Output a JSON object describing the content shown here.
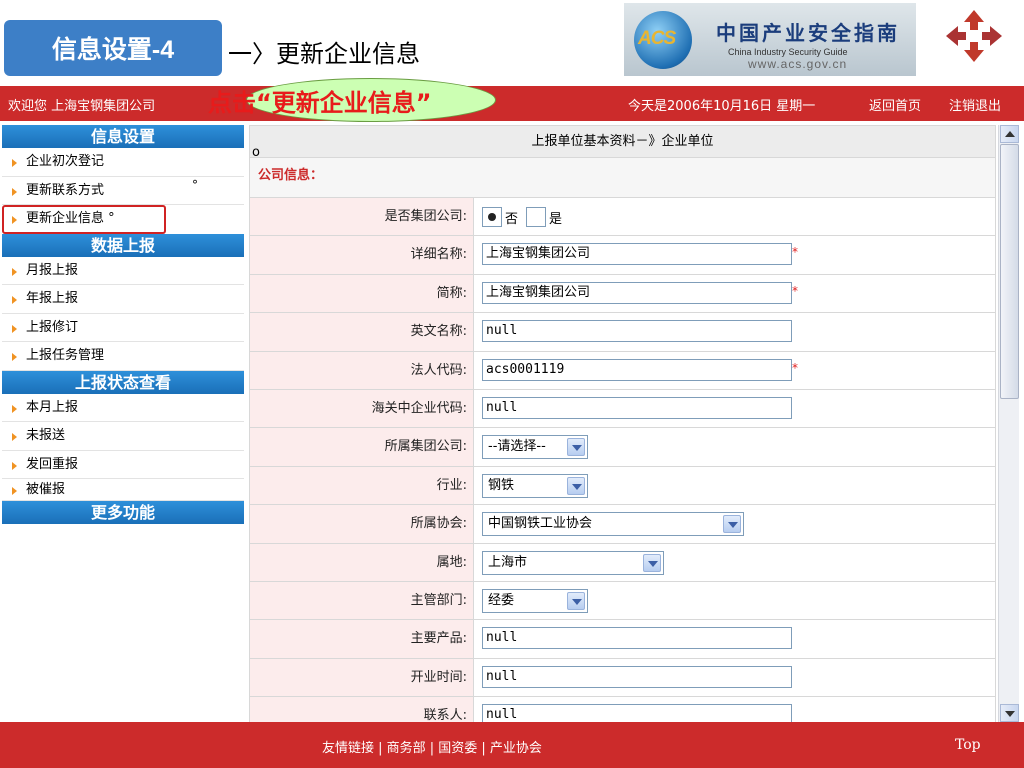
{
  "slide": {
    "title": "信息设置-4",
    "subtitle": "一〉更新企业信息"
  },
  "logo": {
    "acs": "ACS",
    "cn": "中国产业安全指南",
    "en": "China  Industry  Security  Guide",
    "url": "www.acs.gov.cn"
  },
  "topbar": {
    "welcome": "欢迎您 上海宝钢集团公司",
    "callout": "点击“更新企业信息”",
    "date": "今天是2006年10月16日  星期一",
    "home": "返回首页",
    "logout": "注销退出"
  },
  "sidebar": {
    "group1": "信息设置",
    "group1_items": [
      "企业初次登记",
      "更新联系方式",
      "更新企业信息 °"
    ],
    "group2": "数据上报",
    "group2_items": [
      "月报上报",
      "年报上报",
      "上报修订",
      "上报任务管理"
    ],
    "group3": "上报状态查看",
    "group3_items": [
      "本月上报",
      "未报送",
      "发回重报",
      "被催报"
    ],
    "group4": "更多功能",
    "dot": "°"
  },
  "main": {
    "panel_title": "上报单位基本资料－》企业单位",
    "circle_mark": "o",
    "section": "公司信息：",
    "required_mark": "*",
    "is_group_label": "是否集团公司:",
    "radio_no": "否",
    "radio_yes": "是",
    "full_name_label": "详细名称:",
    "full_name": "上海宝钢集团公司",
    "short_name_label": "简称:",
    "short_name": "上海宝钢集团公司",
    "en_name_label": "英文名称:",
    "en_name": "null",
    "legal_code_label": "法人代码:",
    "legal_code": "acs0001119",
    "customs_code_label": "海关中企业代码:",
    "customs_code": "null",
    "parent_group_label": "所属集团公司:",
    "parent_group": "--请选择--",
    "industry_label": "行业:",
    "industry": "钢铁",
    "association_label": "所属协会:",
    "association": "中国钢铁工业协会",
    "location_label": "属地:",
    "location": "上海市",
    "dept_label": "主管部门:",
    "dept": "经委",
    "products_label": "主要产品:",
    "products": "null",
    "open_time_label": "开业时间:",
    "open_time": "null",
    "contact_label": "联系人:",
    "contact": "null"
  },
  "footer": {
    "links": "友情链接 | 商务部 | 国资委 | 产业协会",
    "top": "Top"
  },
  "colors": {
    "red_bar": "#cc2b2b",
    "menu_header": "#1a6fb8",
    "label_bg": "#fcecec",
    "title_box": "#3d7fc7"
  }
}
